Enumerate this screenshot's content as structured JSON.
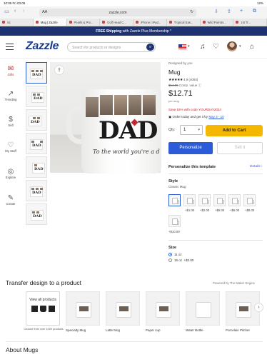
{
  "status_bar": {
    "time": "10:09  Fri 03.05",
    "battery": "12%"
  },
  "browser": {
    "aa": "AA",
    "url": "zazzle.com"
  },
  "tabs": [
    {
      "label": "Sc"
    },
    {
      "label": "Mug | Zazzle"
    },
    {
      "label": "Pearls & Pro..."
    },
    {
      "label": "Golf Head C..."
    },
    {
      "label": "iPhone | iPad..."
    },
    {
      "label": "Tropical Eas..."
    },
    {
      "label": "Wild Parrots..."
    },
    {
      "label": "1st Tr..."
    }
  ],
  "promo": {
    "strong": "FREE Shipping",
    "rest": "with Zazzle Plus Membership *"
  },
  "header": {
    "logo": "Zazzle",
    "search_placeholder": "Search for products or designs"
  },
  "left_nav": [
    {
      "label": "Gifts",
      "icon": "gift-icon"
    },
    {
      "label": "Trending",
      "icon": "trending-icon"
    },
    {
      "label": "Sell",
      "icon": "sell-icon"
    },
    {
      "label": "My Stuff",
      "icon": "heart-icon"
    },
    {
      "label": "Explore",
      "icon": "explore-icon"
    },
    {
      "label": "Create",
      "icon": "create-icon"
    }
  ],
  "product": {
    "designed_by": "Designed by you",
    "title": "Mug",
    "stars": "★★★★★",
    "rating": "4.9 (4093)",
    "old_price": "$14.95",
    "comp_value": "Comp. value ⓘ",
    "price": "$12.71",
    "per_unit": "per mug",
    "sale": "Save 15% with code YOURDAY2024",
    "order_text": "Order today and get it by",
    "order_date": "May 3 - 10",
    "mug_script": "To the world you're a d"
  },
  "purchase": {
    "qty_label": "Qty:",
    "qty_value": "1",
    "add_to_cart": "Add to Cart",
    "personalize": "Personalize",
    "sell_it": "Sell it"
  },
  "template": {
    "title": "Personalize this template",
    "details": "Details"
  },
  "style": {
    "label": "Style",
    "value": "Classic Mug",
    "price_deltas": [
      "+$1.00",
      "+$2.00",
      "+$5.00",
      "+$6.00",
      "+$8.00",
      "+$10.00"
    ]
  },
  "size": {
    "label": "Size",
    "options": [
      {
        "label": "11 oz",
        "extra": ""
      },
      {
        "label": "15 oz",
        "extra": "+$2.00"
      }
    ]
  },
  "transfer": {
    "title": "Transfer design to a product",
    "powered": "Powered by The Maker Engine",
    "view_all": "View all products",
    "choose": "Choose from over 1000 products",
    "products": [
      "Specialty Mug",
      "Latte Mug",
      "Paper cup",
      "Water Bottle",
      "Porcelain Pitcher"
    ]
  },
  "about": {
    "title": "About Mugs"
  },
  "colors": {
    "accent": "#2b5bd6",
    "navy": "#1e3272",
    "cart": "#f5b800",
    "sale": "#c4262e"
  }
}
